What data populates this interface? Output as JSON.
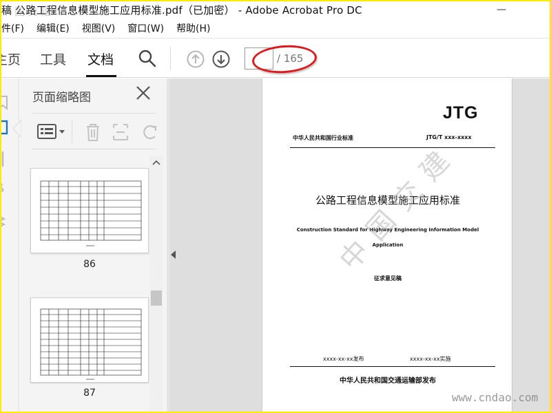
{
  "window": {
    "title": "稿 公路工程信息模型施工应用标准.pdf（已加密） - Adobe Acrobat Pro DC",
    "corner_watermark": "中国交建",
    "controls": [
      "—",
      "□",
      "✕"
    ]
  },
  "menu": {
    "items": [
      "件(F)",
      "编辑(E)",
      "视图(V)",
      "窗口(W)",
      "帮助(H)"
    ]
  },
  "toolbar": {
    "tabs": {
      "home": "主页",
      "tools": "工具",
      "document": "文档"
    },
    "active_tab": "文档",
    "page_number": "",
    "page_total": "/ 165",
    "annotation_color": "#e01818"
  },
  "thumbnail_panel": {
    "title": "页面缩略图",
    "thumbnails": [
      {
        "page_label": "86"
      },
      {
        "page_label": "87"
      }
    ]
  },
  "document": {
    "logo": "JTG",
    "standard_type": "中华人民共和国行业标准",
    "standard_code": "JTG/T xxx-xxxx",
    "title": "公路工程信息模型施工应用标准",
    "english_title_line1": "Construction Standard for Highway Engineering Information Model",
    "english_title_line2": "Application",
    "draft_status": "征求意见稿",
    "issue_date": "xxxx-xx-xx发布",
    "implement_date": "xxxx-xx-xx实施",
    "publisher": "中华人民共和国交通运输部发布",
    "watermark": "中国交建"
  },
  "site_watermark": "www.cndao.com",
  "colors": {
    "frame_border": "#ffeb00",
    "panel_bg": "#f4f4f4",
    "doc_bg": "#dedede"
  }
}
